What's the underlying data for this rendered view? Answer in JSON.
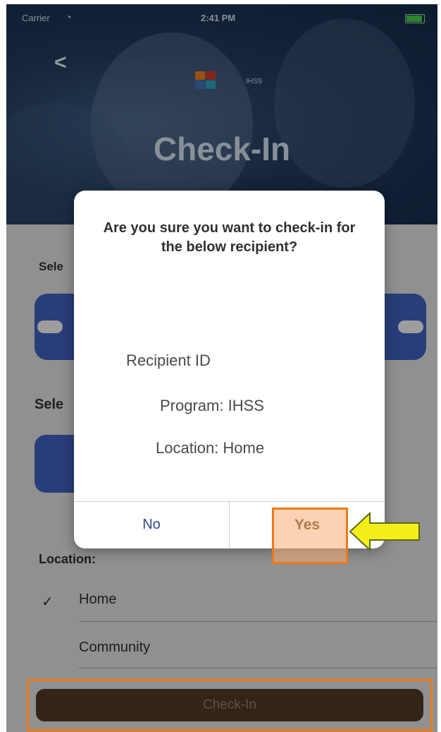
{
  "status_bar": {
    "carrier": "Carrier",
    "time": "2:41 PM"
  },
  "header": {
    "back_label": "<",
    "logo_text": "IHSS",
    "title": "Check-In",
    "logo_colors": [
      "#e07b1e",
      "#3a6fb0",
      "#c23a2a",
      "#2e9bb5"
    ]
  },
  "background": {
    "select_label_1": "Sele",
    "select_label_2": "Sele",
    "location_label": "Location:",
    "location_options": [
      {
        "label": "Home",
        "selected": true
      },
      {
        "label": "Community",
        "selected": false
      }
    ],
    "check_glyph": "✓",
    "checkin_button": "Check-In"
  },
  "dialog": {
    "question": "Are you sure you want to check-in for the below recipient?",
    "recipient_id": "Recipient ID",
    "program": "Program: IHSS",
    "location": "Location: Home",
    "no_label": "No",
    "yes_label": "Yes"
  },
  "colors": {
    "accent_orange": "#ee7a1a",
    "arrow_yellow": "#f5ee1a",
    "button_blue": "#3d5bb2",
    "checkin_brown": "#4a3622"
  }
}
